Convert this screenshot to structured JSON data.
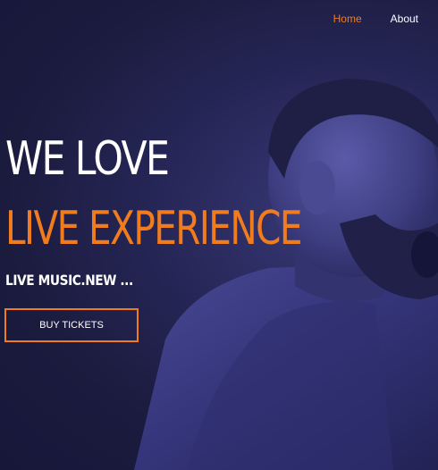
{
  "nav": {
    "items": [
      {
        "label": "Home",
        "active": true
      },
      {
        "label": "About",
        "active": false
      }
    ]
  },
  "hero": {
    "headline_line1": "WE LOVE",
    "headline_line2": "LIVE EXPERIENCE",
    "tagline": "LIVE MUSIC.NEW ...",
    "cta_label": "BUY TICKETS",
    "image": "performer-singing-photo"
  },
  "colors": {
    "accent": "#f07c1e",
    "background": "#1c1c40",
    "text": "#ffffff"
  }
}
